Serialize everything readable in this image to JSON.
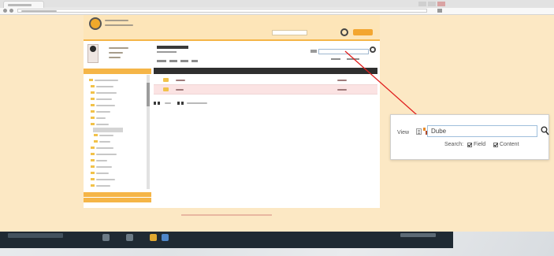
{
  "callout": {
    "view_label": "View",
    "search_value": "Dube",
    "search_caption": "Search:",
    "options": [
      {
        "label": "Field",
        "checked": true
      },
      {
        "label": "Content",
        "checked": true
      }
    ]
  },
  "icons": [
    "search-icon",
    "list-view-icon",
    "tile-view-icon",
    "folder-icon",
    "back-icon",
    "forward-icon"
  ],
  "colors": {
    "accent": "#f5b547",
    "page_background": "#fce8c4",
    "highlight_row": "#fbe3e3",
    "table_header": "#2f2f2f",
    "callout_arrow": "#e0201f",
    "taskbar": "#1f2a33"
  }
}
